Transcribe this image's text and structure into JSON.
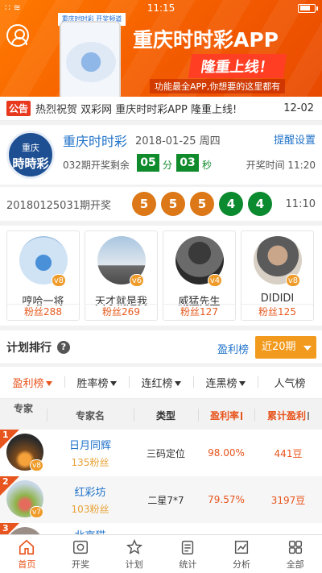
{
  "status_bar": {
    "time": "11:15",
    "left": "∷ ≋"
  },
  "banner": {
    "phone_header": "重庆时时彩  开奖频道 APP",
    "title": "重庆时时彩APP",
    "tag": "隆重上线！",
    "subtitle": "功能最全APP,你想要的这里都有"
  },
  "notice": {
    "badge": "公告",
    "text": "热烈祝贺 双彩网 重庆时时彩APP 隆重上线!",
    "date": "12-02"
  },
  "lottery": {
    "logo_top": "重庆",
    "logo_bottom": "時時彩",
    "name": "重庆时时彩",
    "date": "2018-01-25 周四",
    "remind": "提醒设置",
    "issue_text": "032期开奖剩余",
    "minutes": "05",
    "minute_unit": "分",
    "seconds": "03",
    "second_unit": "秒",
    "open_time": "开奖时间 11:20"
  },
  "results": {
    "label": "20180125031期开奖",
    "balls": [
      {
        "n": "5",
        "color": "orange"
      },
      {
        "n": "5",
        "color": "orange"
      },
      {
        "n": "5",
        "color": "orange"
      },
      {
        "n": "4",
        "color": "green"
      },
      {
        "n": "4",
        "color": "green"
      }
    ],
    "time": "11:10"
  },
  "experts": [
    {
      "name": "哼哈一将",
      "fans": "粉丝288",
      "level": "v8"
    },
    {
      "name": "天才就是我",
      "fans": "粉丝269",
      "level": "v6"
    },
    {
      "name": "威猛先生",
      "fans": "粉丝127",
      "level": "v4"
    },
    {
      "name": "DIDIDI",
      "fans": "粉丝125",
      "level": "v8"
    }
  ],
  "plan": {
    "title": "计划排行",
    "help": "?",
    "filter_label": "盈利榜",
    "period": "近20期"
  },
  "rank_tabs": [
    "盈利榜",
    "胜率榜",
    "连红榜",
    "连黑榜",
    "人气榜"
  ],
  "table": {
    "headers": [
      "专家",
      "专家名",
      "类型",
      "盈利率",
      "累计盈利"
    ],
    "rows": [
      {
        "rank": "1",
        "level": "v8",
        "name": "日月同辉",
        "fans": "135粉丝",
        "type": "三码定位",
        "rate": "98.00%",
        "profit": "441豆"
      },
      {
        "rank": "2",
        "level": "v7",
        "name": "红彩坊",
        "fans": "103粉丝",
        "type": "二星7*7",
        "rate": "79.57%",
        "profit": "3197豆"
      },
      {
        "rank": "3",
        "name": "北京猫"
      }
    ]
  },
  "nav": [
    "首页",
    "开奖",
    "计划",
    "统计",
    "分析",
    "全部"
  ],
  "colors": {
    "accent": "#e8541d",
    "blue": "#1f72c9",
    "green": "#0f8b2c",
    "banner": "#f35b00"
  }
}
